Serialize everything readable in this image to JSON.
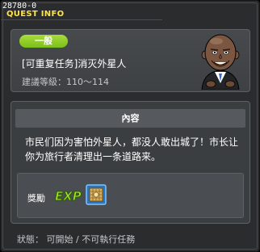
{
  "window": {
    "quest_id": "28780-0",
    "title": "QUEST INFO"
  },
  "quest": {
    "category": "一般",
    "name": "[可重复任务]消灭外星人",
    "level_label": "建議等級：110～114",
    "npc": "portrait-npc"
  },
  "content": {
    "header": "內容",
    "description": "市民们因为害怕外星人，都没人敢出城了！市长让你为旅行者清理出一条道路来。"
  },
  "reward": {
    "label": "獎勵",
    "exp_icon": "exp-icon",
    "item_icon": "reward-scroll-icon"
  },
  "status": {
    "text": "狀態： 可開始 / 不可執行任務"
  },
  "colors": {
    "title": "#ffe34a",
    "badge": "#8ccc22",
    "exp_green": "#9ee52a"
  }
}
